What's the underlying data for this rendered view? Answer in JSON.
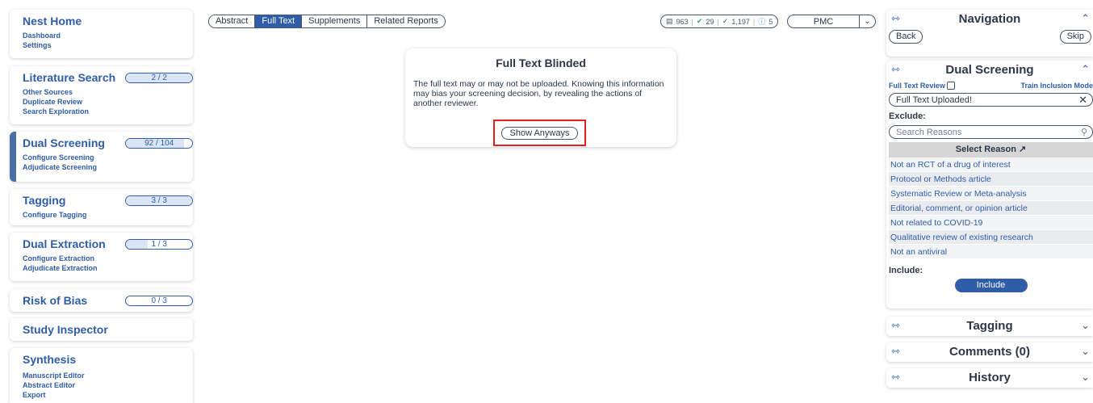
{
  "sidebar": {
    "nest_home": {
      "title": "Nest Home",
      "links": [
        "Dashboard",
        "Settings"
      ]
    },
    "literature_search": {
      "title": "Literature Search",
      "progress": "2 / 2",
      "progress_fraction": 1.0,
      "links": [
        "Other Sources",
        "Duplicate Review",
        "Search Exploration"
      ]
    },
    "dual_screening": {
      "title": "Dual Screening",
      "progress": "92 / 104",
      "progress_fraction": 0.885,
      "links": [
        "Configure Screening",
        "Adjudicate Screening"
      ]
    },
    "tagging": {
      "title": "Tagging",
      "progress": "3 / 3",
      "progress_fraction": 1.0,
      "links": [
        "Configure Tagging"
      ]
    },
    "dual_extraction": {
      "title": "Dual Extraction",
      "progress": "1 / 3",
      "progress_fraction": 0.333,
      "links": [
        "Configure Extraction",
        "Adjudicate Extraction"
      ]
    },
    "risk_of_bias": {
      "title": "Risk of Bias",
      "progress": "0 / 3",
      "progress_fraction": 0.0
    },
    "study_inspector": {
      "title": "Study Inspector"
    },
    "synthesis": {
      "title": "Synthesis",
      "links": [
        "Manuscript Editor",
        "Abstract Editor",
        "Export"
      ]
    }
  },
  "tabs": [
    "Abstract",
    "Full Text",
    "Supplements",
    "Related Reports"
  ],
  "active_tab": "Full Text",
  "stats": {
    "total": "963",
    "included": "29",
    "screened": "1,197",
    "info": "5"
  },
  "source_select": {
    "value": "PMC"
  },
  "blinded": {
    "title": "Full Text Blinded",
    "message": "The full text may or may not be uploaded. Knowing this information may bias your screening decision, by revealing the actions of another reviewer.",
    "button": "Show Anyways"
  },
  "right_panel": {
    "navigation": {
      "title": "Navigation",
      "back": "Back",
      "skip": "Skip"
    },
    "dual_screening": {
      "title": "Dual Screening",
      "full_text_review": "Full Text Review",
      "train_mode": "Train Inclusion Mode",
      "uploaded": "Full Text Uploaded!",
      "exclude_label": "Exclude:",
      "search_placeholder": "Search Reasons",
      "select_reason": "Select Reason",
      "reasons": [
        "Not an RCT of a drug of interest",
        "Protocol or Methods article",
        "Systematic Review or Meta-analysis",
        "Editorial, comment, or opinion article",
        "Not related to COVID-19",
        "Qualitative review of existing research",
        "Not an antiviral"
      ],
      "include_label": "Include:",
      "include_button": "Include"
    },
    "tagging": {
      "title": "Tagging"
    },
    "comments": {
      "title": "Comments (0)"
    },
    "history": {
      "title": "History"
    }
  }
}
